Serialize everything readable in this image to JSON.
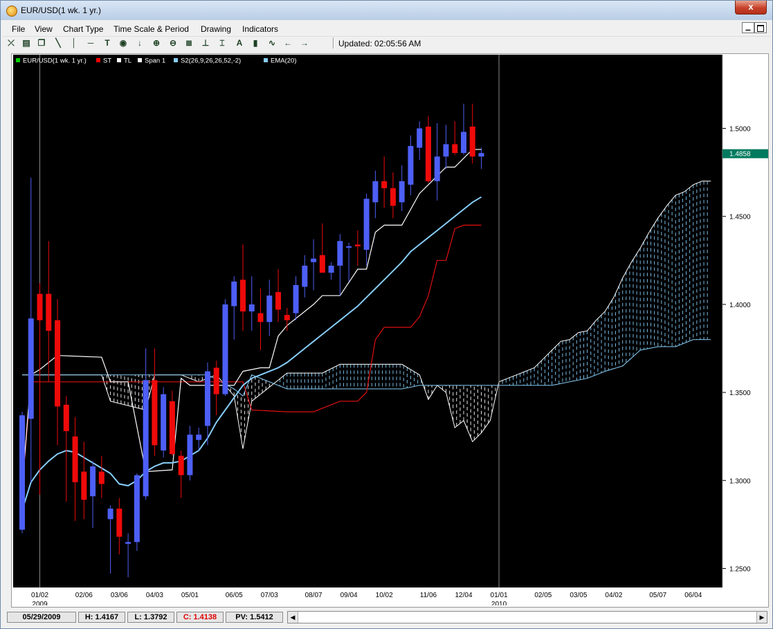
{
  "window": {
    "title": "EUR/USD(1 wk.  1 yr.)",
    "close_label": "x"
  },
  "menu": [
    "File",
    "View",
    "Chart Type",
    "Time Scale & Period",
    "Drawing",
    "Indicators"
  ],
  "toolbar": {
    "icons": [
      "crosshair-icon",
      "print-icon",
      "copy-icon",
      "trendline-icon",
      "vertical-line-icon",
      "horizontal-line-icon",
      "text-icon",
      "circle-icon",
      "arrow-down-icon",
      "zoom-in-icon",
      "zoom-out-icon",
      "fibonacci-icon",
      "measure-icon",
      "annotation-icon",
      "bar-chart-icon",
      "wave-icon",
      "arrow-left-icon",
      "arrow-right-icon"
    ],
    "updated": "Updated: 02:05:56 AM"
  },
  "legend": [
    {
      "label": "EUR/USD(1 wk.  1 yr.)",
      "color": "#00d000"
    },
    {
      "label": "ST",
      "color": "#ff0000"
    },
    {
      "label": "TL",
      "color": "#ffffff"
    },
    {
      "label": "Span 1",
      "color": "#ffffff"
    },
    {
      "label": "S2(26,9,26,26,52,-2)",
      "color": "#87cefa"
    },
    {
      "label": "EMA(20)",
      "color": "#87cefa"
    }
  ],
  "chart_data": {
    "type": "candlestick",
    "instrument": "EUR/USD",
    "ylim": [
      1.235,
      1.555
    ],
    "y_ticks": [
      "1.5000",
      "1.4500",
      "1.4000",
      "1.3500",
      "1.3000",
      "1.2500"
    ],
    "y_tick_values": [
      1.5,
      1.45,
      1.4,
      1.35,
      1.3,
      1.25
    ],
    "last_price": "1.4858",
    "last_price_value": 1.4858,
    "x_ticks": [
      "01/02",
      "02/06",
      "03/06",
      "04/03",
      "05/01",
      "06/05",
      "07/03",
      "08/07",
      "09/04",
      "10/02",
      "11/06",
      "12/04",
      "01/01",
      "02/05",
      "03/05",
      "04/02",
      "05/07",
      "06/04"
    ],
    "x_tick_weeks": [
      2,
      7,
      11,
      15,
      19,
      24,
      28,
      33,
      37,
      41,
      46,
      50,
      54,
      59,
      63,
      67,
      72,
      76
    ],
    "year_labels": [
      {
        "label": "2009",
        "week": 2
      },
      {
        "label": "2010",
        "week": 54
      }
    ],
    "separator_weeks": [
      2,
      54
    ],
    "candles": [
      {
        "o": 1.272,
        "h": 1.339,
        "l": 1.27,
        "c": 1.337
      },
      {
        "o": 1.335,
        "h": 1.472,
        "l": 1.299,
        "c": 1.392
      },
      {
        "o": 1.406,
        "h": 1.412,
        "l": 1.292,
        "c": 1.391
      },
      {
        "o": 1.406,
        "h": 1.436,
        "l": 1.356,
        "c": 1.385
      },
      {
        "o": 1.391,
        "h": 1.403,
        "l": 1.32,
        "c": 1.342
      },
      {
        "o": 1.343,
        "h": 1.348,
        "l": 1.288,
        "c": 1.328
      },
      {
        "o": 1.325,
        "h": 1.336,
        "l": 1.277,
        "c": 1.299
      },
      {
        "o": 1.305,
        "h": 1.322,
        "l": 1.278,
        "c": 1.289
      },
      {
        "o": 1.291,
        "h": 1.311,
        "l": 1.273,
        "c": 1.308
      },
      {
        "o": 1.305,
        "h": 1.314,
        "l": 1.29,
        "c": 1.298
      },
      {
        "o": 1.278,
        "h": 1.286,
        "l": 1.247,
        "c": 1.284
      },
      {
        "o": 1.284,
        "h": 1.29,
        "l": 1.258,
        "c": 1.268
      },
      {
        "o": 1.264,
        "h": 1.27,
        "l": 1.245,
        "c": 1.265
      },
      {
        "o": 1.265,
        "h": 1.304,
        "l": 1.26,
        "c": 1.303
      },
      {
        "o": 1.291,
        "h": 1.375,
        "l": 1.289,
        "c": 1.357
      },
      {
        "o": 1.357,
        "h": 1.375,
        "l": 1.314,
        "c": 1.32
      },
      {
        "o": 1.317,
        "h": 1.353,
        "l": 1.313,
        "c": 1.349
      },
      {
        "o": 1.345,
        "h": 1.351,
        "l": 1.314,
        "c": 1.315
      },
      {
        "o": 1.314,
        "h": 1.317,
        "l": 1.29,
        "c": 1.303
      },
      {
        "o": 1.303,
        "h": 1.331,
        "l": 1.3,
        "c": 1.326
      },
      {
        "o": 1.323,
        "h": 1.33,
        "l": 1.317,
        "c": 1.326
      },
      {
        "o": 1.331,
        "h": 1.367,
        "l": 1.32,
        "c": 1.362
      },
      {
        "o": 1.364,
        "h": 1.368,
        "l": 1.337,
        "c": 1.349
      },
      {
        "o": 1.349,
        "h": 1.403,
        "l": 1.348,
        "c": 1.4
      },
      {
        "o": 1.399,
        "h": 1.416,
        "l": 1.38,
        "c": 1.413
      },
      {
        "o": 1.414,
        "h": 1.434,
        "l": 1.385,
        "c": 1.396
      },
      {
        "o": 1.396,
        "h": 1.416,
        "l": 1.385,
        "c": 1.4
      },
      {
        "o": 1.395,
        "h": 1.409,
        "l": 1.374,
        "c": 1.39
      },
      {
        "o": 1.39,
        "h": 1.414,
        "l": 1.382,
        "c": 1.405
      },
      {
        "o": 1.407,
        "h": 1.42,
        "l": 1.39,
        "c": 1.397
      },
      {
        "o": 1.394,
        "h": 1.398,
        "l": 1.385,
        "c": 1.391
      },
      {
        "o": 1.395,
        "h": 1.416,
        "l": 1.391,
        "c": 1.411
      },
      {
        "o": 1.41,
        "h": 1.428,
        "l": 1.404,
        "c": 1.422
      },
      {
        "o": 1.424,
        "h": 1.437,
        "l": 1.408,
        "c": 1.426
      },
      {
        "o": 1.428,
        "h": 1.446,
        "l": 1.418,
        "c": 1.418
      },
      {
        "o": 1.418,
        "h": 1.424,
        "l": 1.414,
        "c": 1.422
      },
      {
        "o": 1.422,
        "h": 1.44,
        "l": 1.405,
        "c": 1.436
      },
      {
        "o": 1.433,
        "h": 1.435,
        "l": 1.413,
        "c": 1.433
      },
      {
        "o": 1.434,
        "h": 1.442,
        "l": 1.422,
        "c": 1.433
      },
      {
        "o": 1.431,
        "h": 1.463,
        "l": 1.422,
        "c": 1.46
      },
      {
        "o": 1.458,
        "h": 1.476,
        "l": 1.449,
        "c": 1.47
      },
      {
        "o": 1.47,
        "h": 1.484,
        "l": 1.455,
        "c": 1.466
      },
      {
        "o": 1.466,
        "h": 1.475,
        "l": 1.449,
        "c": 1.456
      },
      {
        "o": 1.458,
        "h": 1.479,
        "l": 1.453,
        "c": 1.47
      },
      {
        "o": 1.468,
        "h": 1.496,
        "l": 1.462,
        "c": 1.49
      },
      {
        "o": 1.489,
        "h": 1.504,
        "l": 1.482,
        "c": 1.5
      },
      {
        "o": 1.501,
        "h": 1.507,
        "l": 1.469,
        "c": 1.47
      },
      {
        "o": 1.47,
        "h": 1.503,
        "l": 1.459,
        "c": 1.484
      },
      {
        "o": 1.484,
        "h": 1.502,
        "l": 1.477,
        "c": 1.491
      },
      {
        "o": 1.491,
        "h": 1.504,
        "l": 1.485,
        "c": 1.486
      },
      {
        "o": 1.486,
        "h": 1.514,
        "l": 1.485,
        "c": 1.498
      },
      {
        "o": 1.501,
        "h": 1.514,
        "l": 1.48,
        "c": 1.484
      },
      {
        "o": 1.484,
        "h": 1.489,
        "l": 1.477,
        "c": 1.486
      }
    ],
    "st_line": [
      [
        0,
        1.295
      ],
      [
        1,
        1.356
      ],
      [
        18,
        1.356
      ],
      [
        23,
        1.356
      ],
      [
        25,
        1.356
      ],
      [
        26,
        1.34
      ],
      [
        30,
        1.339
      ],
      [
        33,
        1.339
      ],
      [
        36,
        1.345
      ],
      [
        38,
        1.345
      ],
      [
        39,
        1.35
      ],
      [
        40,
        1.38
      ],
      [
        41,
        1.387
      ],
      [
        43,
        1.387
      ],
      [
        44,
        1.387
      ],
      [
        45,
        1.393
      ],
      [
        46,
        1.405
      ],
      [
        47,
        1.425
      ],
      [
        48,
        1.425
      ],
      [
        49,
        1.443
      ],
      [
        50,
        1.445
      ],
      [
        52,
        1.445
      ]
    ],
    "tl_line": [
      [
        0,
        1.295
      ],
      [
        1,
        1.36
      ],
      [
        2,
        1.363
      ],
      [
        4,
        1.371
      ],
      [
        9,
        1.37
      ],
      [
        10,
        1.356
      ],
      [
        12,
        1.356
      ],
      [
        14,
        1.305
      ],
      [
        17,
        1.306
      ],
      [
        18,
        1.358
      ],
      [
        19,
        1.354
      ],
      [
        24,
        1.354
      ],
      [
        25,
        1.362
      ],
      [
        27,
        1.364
      ],
      [
        28,
        1.364
      ],
      [
        29,
        1.382
      ],
      [
        30,
        1.388
      ],
      [
        33,
        1.4
      ],
      [
        34,
        1.405
      ],
      [
        36,
        1.405
      ],
      [
        38,
        1.42
      ],
      [
        39,
        1.42
      ],
      [
        40,
        1.441
      ],
      [
        41,
        1.445
      ],
      [
        43,
        1.445
      ],
      [
        45,
        1.463
      ],
      [
        46,
        1.468
      ],
      [
        47,
        1.473
      ],
      [
        48,
        1.478
      ],
      [
        49,
        1.478
      ],
      [
        51,
        1.488
      ],
      [
        52,
        1.488
      ]
    ],
    "ema_line": [
      [
        0,
        1.283
      ],
      [
        1,
        1.299
      ],
      [
        2,
        1.306
      ],
      [
        3,
        1.311
      ],
      [
        4,
        1.315
      ],
      [
        5,
        1.317
      ],
      [
        6,
        1.316
      ],
      [
        7,
        1.313
      ],
      [
        8,
        1.31
      ],
      [
        9,
        1.307
      ],
      [
        10,
        1.304
      ],
      [
        11,
        1.298
      ],
      [
        12,
        1.297
      ],
      [
        13,
        1.3
      ],
      [
        14,
        1.305
      ],
      [
        15,
        1.308
      ],
      [
        16,
        1.31
      ],
      [
        17,
        1.31
      ],
      [
        18,
        1.311
      ],
      [
        19,
        1.314
      ],
      [
        20,
        1.317
      ],
      [
        21,
        1.324
      ],
      [
        22,
        1.333
      ],
      [
        23,
        1.34
      ],
      [
        24,
        1.347
      ],
      [
        25,
        1.354
      ],
      [
        26,
        1.358
      ],
      [
        27,
        1.36
      ],
      [
        28,
        1.362
      ],
      [
        29,
        1.364
      ],
      [
        30,
        1.367
      ],
      [
        31,
        1.371
      ],
      [
        32,
        1.375
      ],
      [
        33,
        1.379
      ],
      [
        34,
        1.383
      ],
      [
        35,
        1.387
      ],
      [
        36,
        1.391
      ],
      [
        37,
        1.395
      ],
      [
        38,
        1.399
      ],
      [
        39,
        1.404
      ],
      [
        40,
        1.409
      ],
      [
        41,
        1.414
      ],
      [
        42,
        1.419
      ],
      [
        43,
        1.424
      ],
      [
        44,
        1.43
      ],
      [
        45,
        1.434
      ],
      [
        46,
        1.438
      ],
      [
        47,
        1.442
      ],
      [
        48,
        1.446
      ],
      [
        49,
        1.45
      ],
      [
        50,
        1.454
      ],
      [
        51,
        1.458
      ],
      [
        52,
        1.461
      ]
    ],
    "span1": [
      [
        0,
        1.36
      ],
      [
        4,
        1.36
      ],
      [
        9,
        1.36
      ],
      [
        10,
        1.345
      ],
      [
        14,
        1.34
      ],
      [
        15,
        1.36
      ],
      [
        18,
        1.36
      ],
      [
        20,
        1.356
      ],
      [
        22,
        1.36
      ],
      [
        24,
        1.348
      ],
      [
        25,
        1.318
      ],
      [
        26,
        1.345
      ],
      [
        30,
        1.361
      ],
      [
        34,
        1.361
      ],
      [
        36,
        1.366
      ],
      [
        43,
        1.366
      ],
      [
        45,
        1.36
      ],
      [
        46,
        1.346
      ],
      [
        47,
        1.354
      ],
      [
        48,
        1.35
      ],
      [
        49,
        1.33
      ],
      [
        50,
        1.334
      ],
      [
        51,
        1.322
      ],
      [
        52,
        1.327
      ],
      [
        53,
        1.334
      ],
      [
        54,
        1.356
      ],
      [
        55,
        1.358
      ],
      [
        56,
        1.36
      ],
      [
        57,
        1.362
      ],
      [
        58,
        1.364
      ],
      [
        59,
        1.369
      ],
      [
        60,
        1.374
      ],
      [
        61,
        1.379
      ],
      [
        62,
        1.38
      ],
      [
        63,
        1.384
      ],
      [
        64,
        1.385
      ],
      [
        65,
        1.391
      ],
      [
        66,
        1.396
      ],
      [
        67,
        1.404
      ],
      [
        68,
        1.415
      ],
      [
        69,
        1.424
      ],
      [
        70,
        1.432
      ],
      [
        71,
        1.441
      ],
      [
        72,
        1.449
      ],
      [
        73,
        1.456
      ],
      [
        74,
        1.462
      ],
      [
        75,
        1.464
      ],
      [
        76,
        1.468
      ],
      [
        77,
        1.47
      ],
      [
        78,
        1.47
      ]
    ],
    "span2": [
      [
        0,
        1.36
      ],
      [
        4,
        1.36
      ],
      [
        10,
        1.36
      ],
      [
        14,
        1.36
      ],
      [
        18,
        1.36
      ],
      [
        21,
        1.36
      ],
      [
        24,
        1.352
      ],
      [
        25,
        1.348
      ],
      [
        26,
        1.36
      ],
      [
        30,
        1.352
      ],
      [
        36,
        1.352
      ],
      [
        39,
        1.352
      ],
      [
        43,
        1.352
      ],
      [
        45,
        1.354
      ],
      [
        48,
        1.354
      ],
      [
        52,
        1.354
      ],
      [
        54,
        1.354
      ],
      [
        56,
        1.354
      ],
      [
        58,
        1.354
      ],
      [
        60,
        1.354
      ],
      [
        62,
        1.356
      ],
      [
        64,
        1.358
      ],
      [
        66,
        1.362
      ],
      [
        68,
        1.365
      ],
      [
        70,
        1.374
      ],
      [
        72,
        1.376
      ],
      [
        74,
        1.376
      ],
      [
        76,
        1.38
      ],
      [
        78,
        1.38
      ]
    ]
  },
  "status": {
    "date": "05/29/2009",
    "high": "H: 1.4167",
    "low": "L: 1.3792",
    "close": "C: 1.4138",
    "pv": "PV: 1.5412"
  }
}
